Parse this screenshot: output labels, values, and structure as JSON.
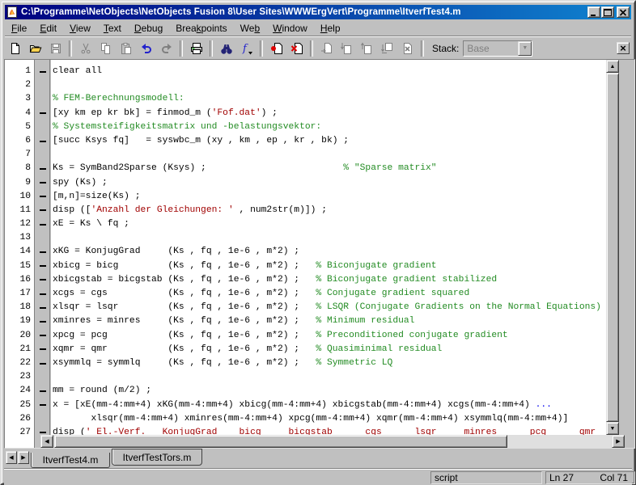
{
  "window": {
    "title": "C:\\Programme\\NetObjects\\NetObjects Fusion 8\\User Sites\\WWWErgVert\\Programme\\ItverfTest4.m",
    "controls": [
      {
        "name": "minimize"
      },
      {
        "name": "maximize"
      },
      {
        "name": "close"
      }
    ]
  },
  "menu": {
    "items": [
      {
        "label": "File",
        "accel": 0
      },
      {
        "label": "Edit",
        "accel": 0
      },
      {
        "label": "View",
        "accel": 0
      },
      {
        "label": "Text",
        "accel": 0
      },
      {
        "label": "Debug",
        "accel": 0
      },
      {
        "label": "Breakpoints",
        "accel": 4
      },
      {
        "label": "Web",
        "accel": 2
      },
      {
        "label": "Window",
        "accel": 0
      },
      {
        "label": "Help",
        "accel": 0
      }
    ]
  },
  "toolbar": {
    "buttons": [
      {
        "name": "new-file",
        "enabled": true
      },
      {
        "name": "open-file",
        "enabled": true
      },
      {
        "name": "save-file",
        "enabled": false
      },
      {
        "sep": true
      },
      {
        "name": "cut",
        "enabled": false
      },
      {
        "name": "copy",
        "enabled": false
      },
      {
        "name": "paste",
        "enabled": false
      },
      {
        "name": "undo",
        "enabled": true
      },
      {
        "name": "redo",
        "enabled": false
      },
      {
        "sep": true
      },
      {
        "name": "print",
        "enabled": true
      },
      {
        "sep": true
      },
      {
        "name": "find",
        "enabled": true
      },
      {
        "name": "function",
        "enabled": true
      },
      {
        "sep": true
      },
      {
        "name": "breakpoint-set",
        "enabled": true
      },
      {
        "name": "breakpoint-clear-all",
        "enabled": true
      },
      {
        "sep": true
      },
      {
        "name": "step",
        "enabled": false
      },
      {
        "name": "step-in",
        "enabled": false
      },
      {
        "name": "step-out",
        "enabled": false
      },
      {
        "name": "continue",
        "enabled": false
      },
      {
        "name": "exit-debug",
        "enabled": false
      },
      {
        "sep": true
      }
    ],
    "stack_label": "Stack:",
    "stack_value": "Base",
    "close_glyph": "×"
  },
  "editor": {
    "lines": [
      {
        "n": 1,
        "exec": true,
        "segs": [
          [
            "code",
            "clear all"
          ]
        ]
      },
      {
        "n": 2,
        "exec": false,
        "segs": []
      },
      {
        "n": 3,
        "exec": false,
        "segs": [
          [
            "comment",
            "% FEM-Berechnungsmodell:"
          ]
        ]
      },
      {
        "n": 4,
        "exec": true,
        "segs": [
          [
            "code",
            "[xy km ep kr bk] = finmod_m ("
          ],
          [
            "string",
            "'Fof.dat'"
          ],
          [
            "code",
            ") ;"
          ]
        ]
      },
      {
        "n": 5,
        "exec": false,
        "segs": [
          [
            "comment",
            "% Systemsteifigkeitsmatrix und -belastungsvektor:"
          ]
        ]
      },
      {
        "n": 6,
        "exec": true,
        "segs": [
          [
            "code",
            "[succ Ksys fq]   = syswbc_m (xy , km , ep , kr , bk) ;"
          ]
        ]
      },
      {
        "n": 7,
        "exec": false,
        "segs": []
      },
      {
        "n": 8,
        "exec": true,
        "segs": [
          [
            "code",
            "Ks = SymBand2Sparse (Ksys) ;"
          ],
          [
            "comment",
            "                         % \"Sparse matrix\""
          ]
        ]
      },
      {
        "n": 9,
        "exec": true,
        "segs": [
          [
            "code",
            "spy (Ks) ;"
          ]
        ]
      },
      {
        "n": 10,
        "exec": true,
        "segs": [
          [
            "code",
            "[m,n]=size(Ks) ;"
          ]
        ]
      },
      {
        "n": 11,
        "exec": true,
        "segs": [
          [
            "code",
            "disp (["
          ],
          [
            "string",
            "'Anzahl der Gleichungen: '"
          ],
          [
            "code",
            " , num2str(m)]) ;"
          ]
        ]
      },
      {
        "n": 12,
        "exec": true,
        "segs": [
          [
            "code",
            "xE = Ks \\ fq ;"
          ]
        ]
      },
      {
        "n": 13,
        "exec": false,
        "segs": []
      },
      {
        "n": 14,
        "exec": true,
        "segs": [
          [
            "code",
            "xKG = KonjugGrad     (Ks , fq , 1e-6 , m*2) ;"
          ]
        ]
      },
      {
        "n": 15,
        "exec": true,
        "segs": [
          [
            "code",
            "xbicg = bicg         (Ks , fq , 1e-6 , m*2) ;"
          ],
          [
            "comment",
            "   % Biconjugate gradient"
          ]
        ]
      },
      {
        "n": 16,
        "exec": true,
        "segs": [
          [
            "code",
            "xbicgstab = bicgstab (Ks , fq , 1e-6 , m*2) ;"
          ],
          [
            "comment",
            "   % Biconjugate gradient stabilized"
          ]
        ]
      },
      {
        "n": 17,
        "exec": true,
        "segs": [
          [
            "code",
            "xcgs = cgs           (Ks , fq , 1e-6 , m*2) ;"
          ],
          [
            "comment",
            "   % Conjugate gradient squared"
          ]
        ]
      },
      {
        "n": 18,
        "exec": true,
        "segs": [
          [
            "code",
            "xlsqr = lsqr         (Ks , fq , 1e-6 , m*2) ;"
          ],
          [
            "comment",
            "   % LSQR (Conjugate Gradients on the Normal Equations)"
          ]
        ]
      },
      {
        "n": 19,
        "exec": true,
        "segs": [
          [
            "code",
            "xminres = minres     (Ks , fq , 1e-6 , m*2) ;"
          ],
          [
            "comment",
            "   % Minimum residual"
          ]
        ]
      },
      {
        "n": 20,
        "exec": true,
        "segs": [
          [
            "code",
            "xpcg = pcg           (Ks , fq , 1e-6 , m*2) ;"
          ],
          [
            "comment",
            "   % Preconditioned conjugate gradient"
          ]
        ]
      },
      {
        "n": 21,
        "exec": true,
        "segs": [
          [
            "code",
            "xqmr = qmr           (Ks , fq , 1e-6 , m*2) ;"
          ],
          [
            "comment",
            "   % Quasiminimal residual"
          ]
        ]
      },
      {
        "n": 22,
        "exec": true,
        "segs": [
          [
            "code",
            "xsymmlq = symmlq     (Ks , fq , 1e-6 , m*2) ;"
          ],
          [
            "comment",
            "   % Symmetric LQ"
          ]
        ]
      },
      {
        "n": 23,
        "exec": false,
        "segs": []
      },
      {
        "n": 24,
        "exec": true,
        "segs": [
          [
            "code",
            "mm = round (m/2) ;"
          ]
        ]
      },
      {
        "n": 25,
        "exec": true,
        "segs": [
          [
            "code",
            "x = [xE(mm-4:mm+4) xKG(mm-4:mm+4) xbicg(mm-4:mm+4) xbicgstab(mm-4:mm+4) xcgs(mm-4:mm+4) "
          ],
          [
            "cont",
            "..."
          ]
        ]
      },
      {
        "n": 26,
        "exec": false,
        "segs": [
          [
            "code",
            "       xlsqr(mm-4:mm+4) xminres(mm-4:mm+4) xpcg(mm-4:mm+4) xqmr(mm-4:mm+4) xsymmlq(mm-4:mm+4)]"
          ]
        ]
      },
      {
        "n": 27,
        "exec": true,
        "segs": [
          [
            "code",
            "disp ("
          ],
          [
            "string",
            "' El.-Verf.   KonjugGrad    bicg     bicgstab      cgs      lsqr     minres      pcg      qmr"
          ]
        ]
      }
    ]
  },
  "tabs": {
    "items": [
      {
        "label": "ItverfTest4.m",
        "active": true
      },
      {
        "label": "ItverfTestTors.m",
        "active": false
      }
    ]
  },
  "status": {
    "file_type": "script",
    "line": "Ln 27",
    "col": "Col 71"
  },
  "colors": {
    "comment": "#228B22",
    "string": "#A00000",
    "continuation": "#0000EE",
    "titlebar_left": "#000080",
    "titlebar_right": "#1084d0",
    "chrome": "#c0c0c0"
  }
}
